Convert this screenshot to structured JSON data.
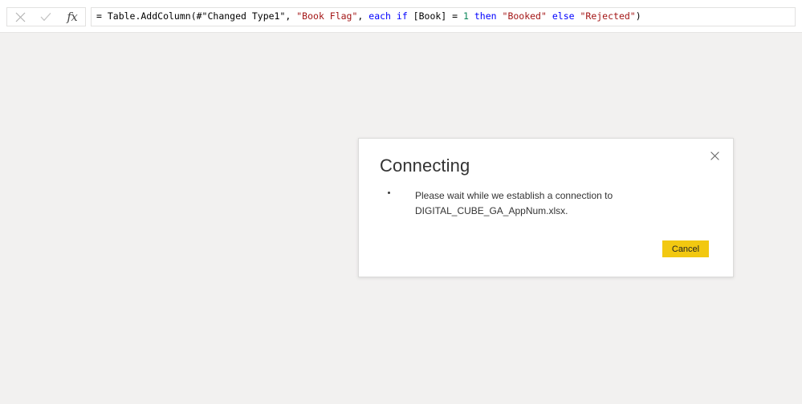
{
  "formula_bar": {
    "cancel_icon": "close-x-icon",
    "commit_icon": "checkmark-icon",
    "function_icon": "fx-icon",
    "fx_label": "fx",
    "formula_full_text": "= Table.AddColumn(#\"Changed Type1\", \"Book Flag\", each if [Book] = 1 then \"Booked\" else \"Rejected\")",
    "tokens": [
      {
        "text": "= Table.AddColumn(#\"Changed Type1\", ",
        "type": "plain"
      },
      {
        "text": "\"Book Flag\"",
        "type": "string"
      },
      {
        "text": ", ",
        "type": "plain"
      },
      {
        "text": "each if",
        "type": "kw"
      },
      {
        "text": " [Book] = ",
        "type": "plain"
      },
      {
        "text": "1",
        "type": "num"
      },
      {
        "text": " ",
        "type": "plain"
      },
      {
        "text": "then",
        "type": "kw"
      },
      {
        "text": " ",
        "type": "plain"
      },
      {
        "text": "\"Booked\"",
        "type": "string"
      },
      {
        "text": " ",
        "type": "plain"
      },
      {
        "text": "else",
        "type": "kw"
      },
      {
        "text": " ",
        "type": "plain"
      },
      {
        "text": "\"Rejected\"",
        "type": "string"
      },
      {
        "text": ")",
        "type": "plain"
      }
    ]
  },
  "dialog": {
    "title": "Connecting",
    "message": "Please wait while we establish a connection to DIGITAL_CUBE_GA_AppNum.xlsx.",
    "file_name": "DIGITAL_CUBE_GA_AppNum.xlsx",
    "close_icon": "close-x-icon",
    "progress_indicator": "loading-dot-indicator",
    "cancel_label": "Cancel"
  },
  "colors": {
    "page_background": "#f2f1f0",
    "formula_bar_background": "#ffffff",
    "dialog_background": "#ffffff",
    "dialog_border": "#dcdbda",
    "accent_yellow": "#f2c811",
    "text_primary": "#333333",
    "syntax_string": "#a31515",
    "syntax_keyword": "#0000ff",
    "syntax_number": "#098658"
  }
}
